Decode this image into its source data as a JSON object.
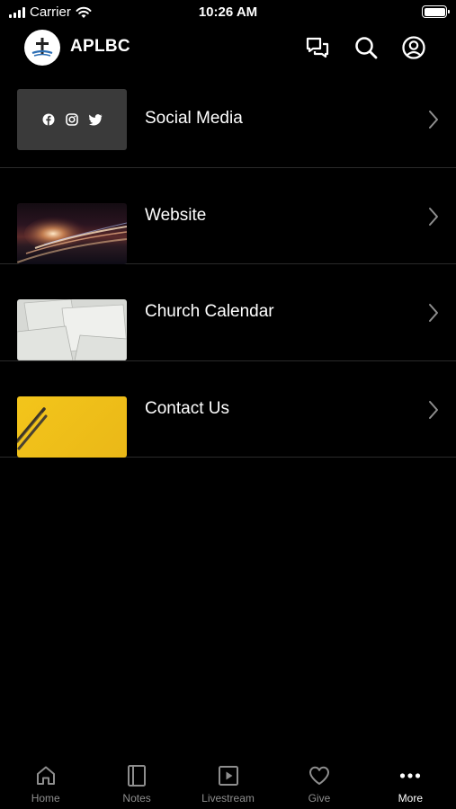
{
  "status_bar": {
    "carrier": "Carrier",
    "time": "10:26 AM"
  },
  "header": {
    "title": "APLBC",
    "logo_icon": "cross-logo-icon"
  },
  "menu": [
    {
      "label": "Social Media",
      "thumb": "social-media-thumbnail"
    },
    {
      "label": "Website",
      "thumb": "website-thumbnail"
    },
    {
      "label": "Church Calendar",
      "thumb": "calendar-thumbnail"
    },
    {
      "label": "Contact Us",
      "thumb": "contact-thumbnail"
    }
  ],
  "tabs": [
    {
      "label": "Home",
      "icon": "home-icon",
      "active": false
    },
    {
      "label": "Notes",
      "icon": "notes-icon",
      "active": false
    },
    {
      "label": "Livestream",
      "icon": "play-icon",
      "active": false
    },
    {
      "label": "Give",
      "icon": "heart-icon",
      "active": false
    },
    {
      "label": "More",
      "icon": "more-icon",
      "active": true
    }
  ],
  "colors": {
    "background": "#000000",
    "text": "#ffffff",
    "tab_inactive": "#8e8e8e",
    "divider": "#2a2a2a"
  }
}
